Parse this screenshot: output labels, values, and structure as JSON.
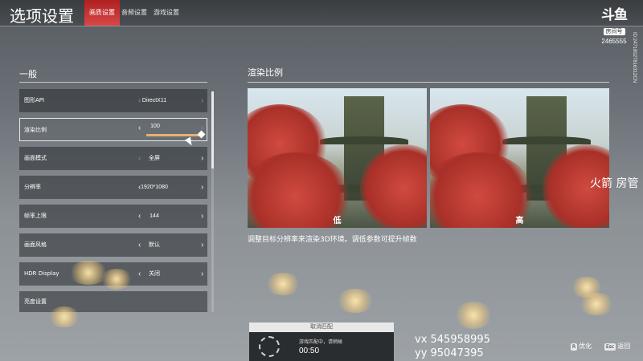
{
  "header": {
    "title": "选项设置",
    "tabs": [
      {
        "label": "画质设置",
        "active": true
      },
      {
        "label": "音频设置",
        "active": false
      },
      {
        "label": "游戏设置",
        "active": false
      }
    ]
  },
  "brand": {
    "logo_text": "斗鱼",
    "logo_sub": "房间号",
    "room_id": "2465555",
    "side_id": "ID:24718027816312CN"
  },
  "general": {
    "title": "一般",
    "rows": [
      {
        "label": "图形API",
        "value": "DirectX11"
      },
      {
        "label": "渲染比例",
        "value": "100",
        "slider_fraction": 1.0
      },
      {
        "label": "画面模式",
        "value": "全屏"
      },
      {
        "label": "分辨率",
        "value": "1920*1080"
      },
      {
        "label": "帧率上限",
        "value": "144"
      },
      {
        "label": "画面风格",
        "value": "默认"
      },
      {
        "label": "HDR Display",
        "value": "关闭"
      },
      {
        "label": "亮度设置",
        "value": ""
      }
    ]
  },
  "preview": {
    "title": "渲染比例",
    "low_label": "低",
    "high_label": "高",
    "description": "调整目标分辨率来渲染3D环境。调低参数可提升帧数"
  },
  "matchmaking": {
    "cancel_label": "取消匹配",
    "status": "游戏匹配中，请稍候",
    "timer": "00:50"
  },
  "key_hints": [
    {
      "key": "R",
      "label": "优化"
    },
    {
      "key": "Esc",
      "label": "返回"
    }
  ],
  "overlay_texts": {
    "streamer": "火箭 房管",
    "vx": "vx 545958995",
    "yy": "yy 95047395"
  },
  "colors": {
    "active_tab": "#c83232",
    "slider_fill": "#e8b070"
  }
}
